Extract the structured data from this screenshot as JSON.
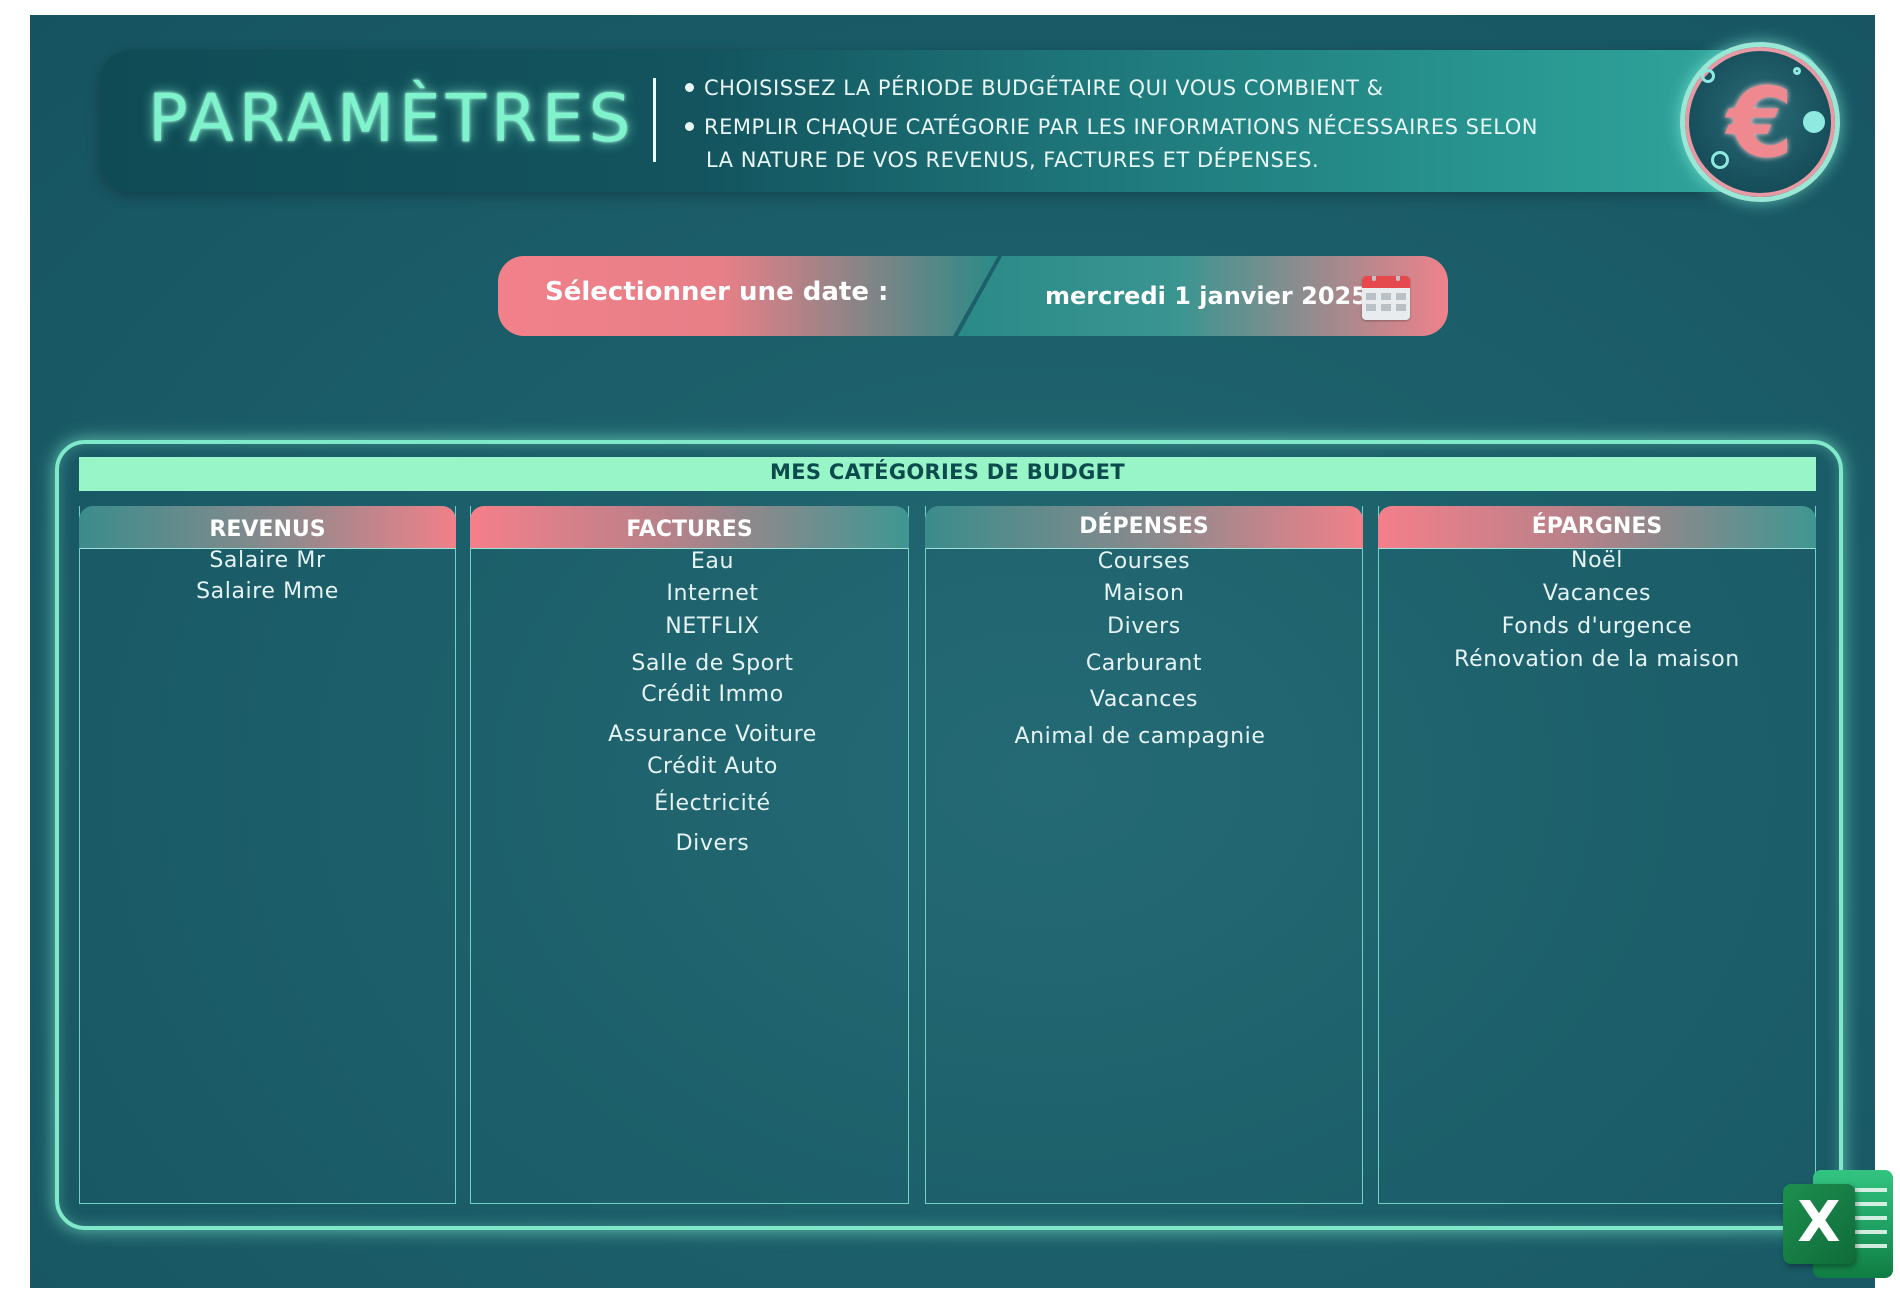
{
  "banner": {
    "title": "PARAMÈTRES",
    "instruction_1": "CHOISISSEZ LA PÉRIODE BUDGÉTAIRE QUI VOUS COMBIENT &",
    "instruction_2_line1": "REMPLIR CHAQUE CATÉGORIE PAR LES INFORMATIONS NÉCESSAIRES SELON",
    "instruction_2_line2": "LA NATURE DE VOS REVENUS, FACTURES ET DÉPENSES.",
    "badge_icon": "euro-icon",
    "badge_symbol": "€"
  },
  "date_selector": {
    "label": "Sélectionner une date :",
    "value": "mercredi 1 janvier 2025",
    "icon": "calendar-icon"
  },
  "categories": {
    "title": "MES CATÉGORIES DE BUDGET",
    "revenus": {
      "header": "REVENUS",
      "items": [
        "Salaire Mr",
        "Salaire Mme"
      ]
    },
    "factures": {
      "header": "FACTURES",
      "items": [
        "Eau",
        "Internet",
        "NETFLIX",
        "Salle de Sport",
        "Crédit Immo",
        "Assurance Voiture",
        "Crédit Auto",
        "Électricité",
        "Divers"
      ]
    },
    "depenses": {
      "header": "DÉPENSES",
      "items": [
        "Courses",
        "Maison",
        "Divers",
        "Carburant",
        "Vacances",
        "Animal de campagnie"
      ]
    },
    "epargnes": {
      "header": "ÉPARGNES",
      "items": [
        "Noël",
        "Vacances",
        "Fonds d'urgence",
        "Rénovation de la maison"
      ]
    }
  },
  "app_icon": {
    "name": "excel-icon",
    "letter": "X"
  },
  "colors": {
    "background": "#1c5f6a",
    "accent_mint": "#98f5c8",
    "accent_pink": "#f2808a",
    "glow": "#7fe9c9"
  }
}
